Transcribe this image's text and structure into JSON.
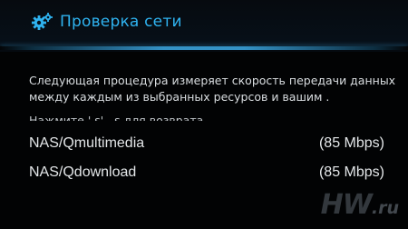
{
  "header": {
    "icon": "gear-icon",
    "title": "Проверка сети"
  },
  "colors": {
    "accent": "#2fb3f0",
    "background": "#030507",
    "text": "#e3e6e8"
  },
  "main": {
    "description": "Следующая процедура измеряет скорость передачи данных между каждым из выбранных ресурсов и вашим .",
    "hint": "Нажмите ' s' . s для возврата"
  },
  "resources": [
    {
      "name": "NAS/Qmultimedia",
      "speed": "(85 Mbps)"
    },
    {
      "name": "NAS/Qdownload",
      "speed": "(85 Mbps)"
    }
  ],
  "watermark": {
    "brand": "HW",
    "domain": ".ru"
  }
}
